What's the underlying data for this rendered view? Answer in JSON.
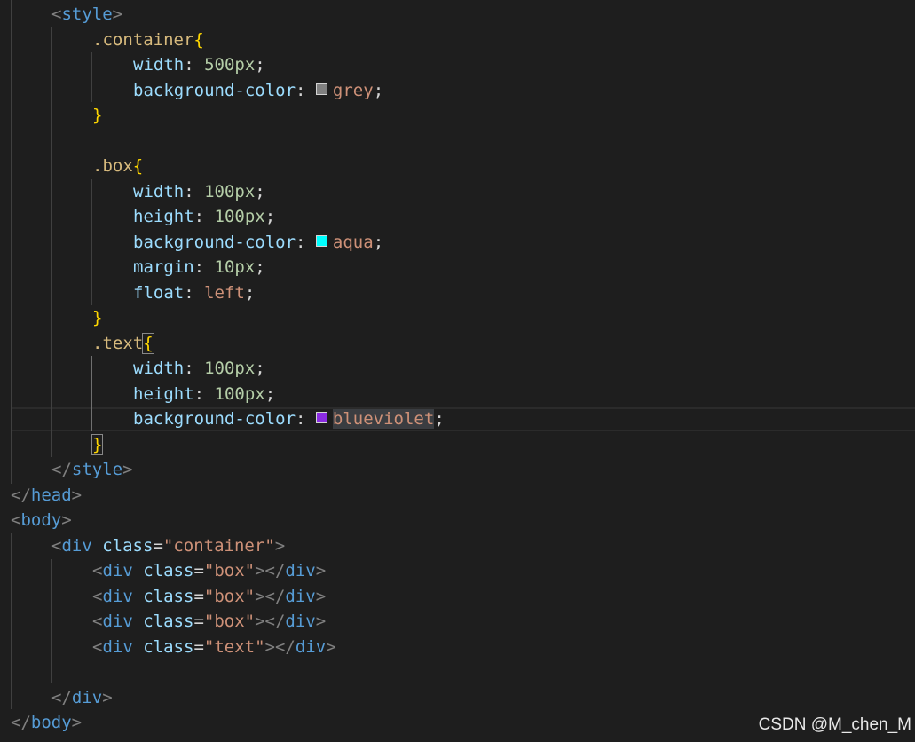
{
  "style_block": {
    "open_tag": "style",
    "close_tag": "style",
    "rules": [
      {
        "selector": ".container",
        "declarations": [
          {
            "property": "width",
            "number": "500px"
          },
          {
            "property": "background-color",
            "keyword": "grey",
            "swatch": "#808080"
          }
        ]
      },
      {
        "selector": ".box",
        "declarations": [
          {
            "property": "width",
            "number": "100px"
          },
          {
            "property": "height",
            "number": "100px"
          },
          {
            "property": "background-color",
            "keyword": "aqua",
            "swatch": "#00ffff"
          },
          {
            "property": "margin",
            "number": "10px"
          },
          {
            "property": "float",
            "keyword": "left"
          }
        ]
      },
      {
        "selector": ".text",
        "declarations": [
          {
            "property": "width",
            "number": "100px"
          },
          {
            "property": "height",
            "number": "100px"
          },
          {
            "property": "background-color",
            "keyword": "blueviolet",
            "swatch": "#8a2be2"
          }
        ]
      }
    ]
  },
  "html": {
    "head_close": "head",
    "body_open": "body",
    "body_close": "body",
    "div_tag": "div",
    "attr_class": "class",
    "container_class": "\"container\"",
    "box_class": "\"box\"",
    "text_class": "\"text\""
  },
  "watermark": "CSDN @M_chen_M",
  "colors": {
    "background": "#1e1e1e",
    "tag": "#569cd6",
    "attribute": "#9cdcfe",
    "string": "#ce9178",
    "selector": "#d7ba7d",
    "brace": "#ffd700",
    "number": "#b5cea8"
  }
}
